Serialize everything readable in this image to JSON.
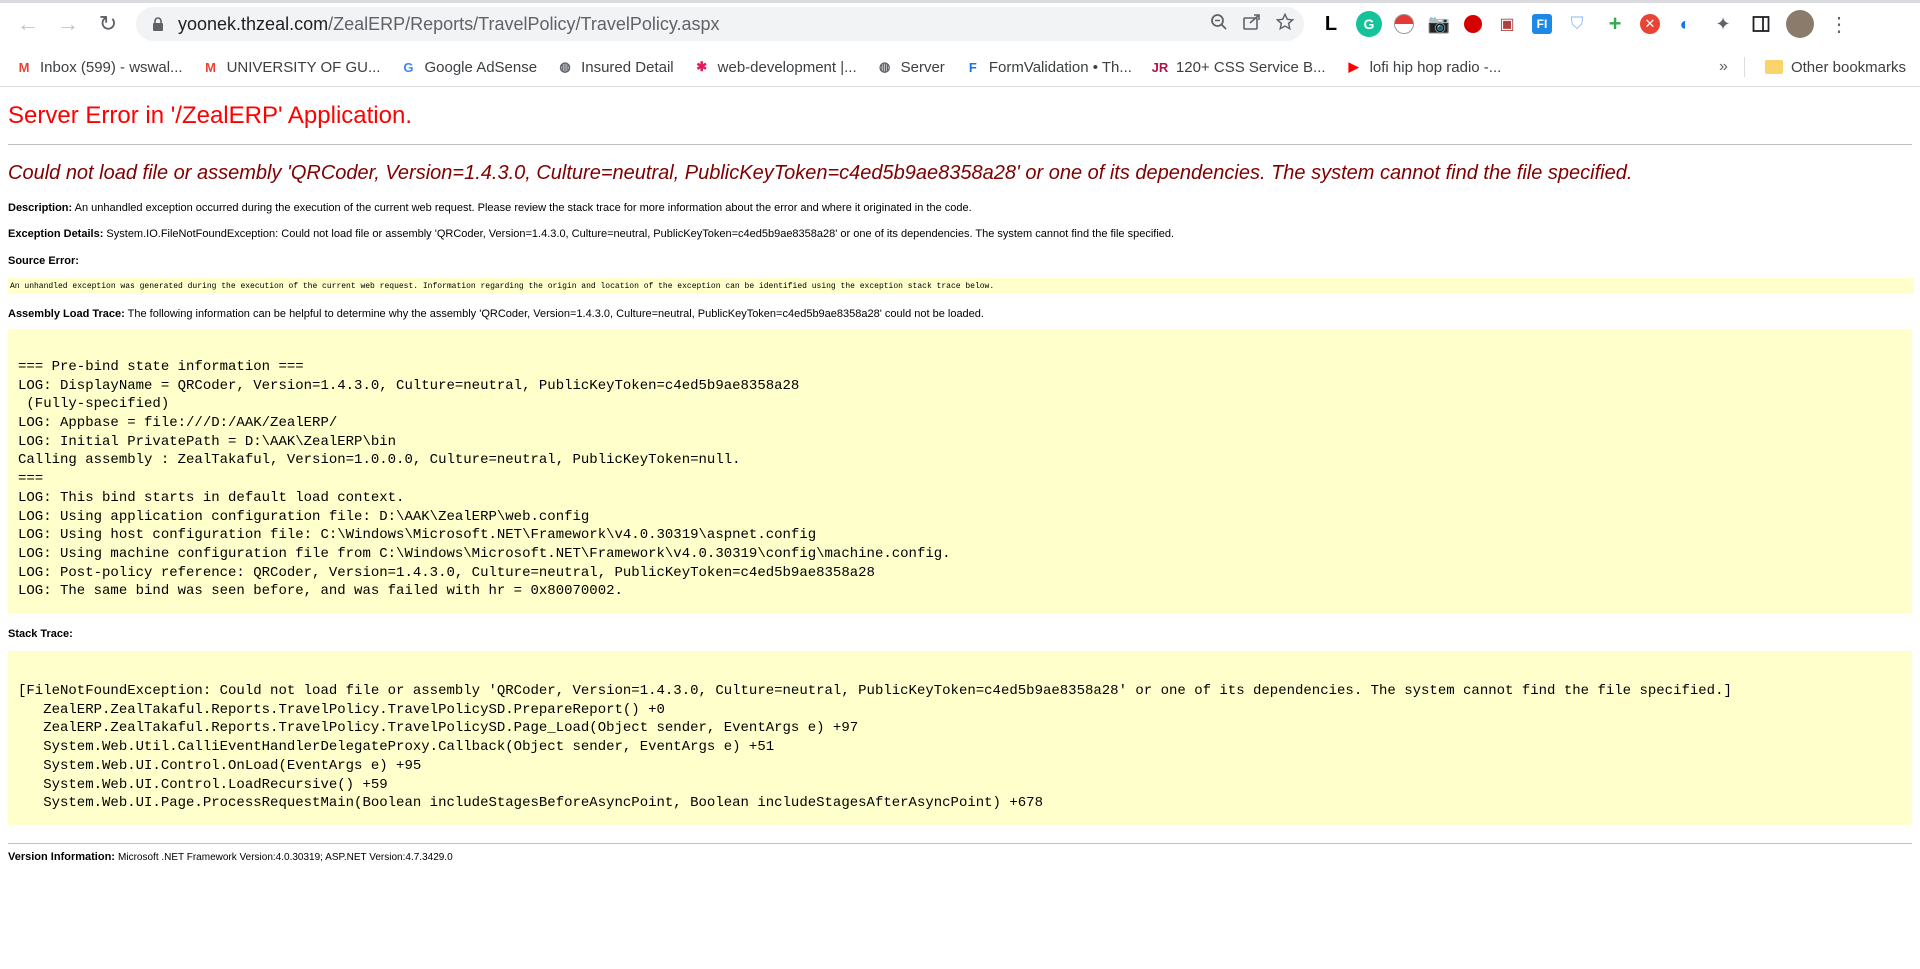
{
  "browser": {
    "url_host": "yoonek.thzeal.com",
    "url_path": "/ZealERP/Reports/TravelPolicy/TravelPolicy.aspx",
    "bookmarks": [
      {
        "label": "Inbox (599) - wswal...",
        "icon": "gmail-icon",
        "color": "#ea4335",
        "glyph": "M"
      },
      {
        "label": "UNIVERSITY OF GU...",
        "icon": "gmail-icon",
        "color": "#ea4335",
        "glyph": "M"
      },
      {
        "label": "Google AdSense",
        "icon": "google-icon",
        "color": "#4285f4",
        "glyph": "G"
      },
      {
        "label": "Insured Detail",
        "icon": "globe-icon",
        "color": "#5f6368",
        "glyph": "◍"
      },
      {
        "label": "web-development |...",
        "icon": "slack-icon",
        "color": "#e01e5a",
        "glyph": "✱"
      },
      {
        "label": "Server",
        "icon": "globe-icon",
        "color": "#5f6368",
        "glyph": "◍"
      },
      {
        "label": "FormValidation • Th...",
        "icon": "formvalidation-icon",
        "color": "#1a73e8",
        "glyph": "F"
      },
      {
        "label": "120+ CSS Service B...",
        "icon": "jr-icon",
        "color": "#b3134b",
        "glyph": "JR"
      },
      {
        "label": "lofi hip hop radio -...",
        "icon": "youtube-icon",
        "color": "#ff0000",
        "glyph": "▶"
      }
    ],
    "other_bookmarks": "Other bookmarks"
  },
  "page": {
    "title": "Server Error in '/ZealERP' Application.",
    "error_heading": "Could not load file or assembly 'QRCoder, Version=1.4.3.0, Culture=neutral, PublicKeyToken=c4ed5b9ae8358a28' or one of its dependencies. The system cannot find the file specified.",
    "description_label": "Description:",
    "description_text": "An unhandled exception occurred during the execution of the current web request. Please review the stack trace for more information about the error and where it originated in the code.",
    "exception_label": "Exception Details:",
    "exception_text": "System.IO.FileNotFoundException: Could not load file or assembly 'QRCoder, Version=1.4.3.0, Culture=neutral, PublicKeyToken=c4ed5b9ae8358a28' or one of its dependencies. The system cannot find the file specified.",
    "source_error_label": "Source Error:",
    "source_error_text": "An unhandled exception was generated during the execution of the current web request. Information regarding the origin and location of the exception can be identified using the exception stack trace below.",
    "assembly_label": "Assembly Load Trace:",
    "assembly_text": "The following information can be helpful to determine why the assembly 'QRCoder, Version=1.4.3.0, Culture=neutral, PublicKeyToken=c4ed5b9ae8358a28' could not be loaded.",
    "assembly_trace": "\n=== Pre-bind state information ===\nLOG: DisplayName = QRCoder, Version=1.4.3.0, Culture=neutral, PublicKeyToken=c4ed5b9ae8358a28\n (Fully-specified)\nLOG: Appbase = file:///D:/AAK/ZealERP/\nLOG: Initial PrivatePath = D:\\AAK\\ZealERP\\bin\nCalling assembly : ZealTakaful, Version=1.0.0.0, Culture=neutral, PublicKeyToken=null.\n===\nLOG: This bind starts in default load context.\nLOG: Using application configuration file: D:\\AAK\\ZealERP\\web.config\nLOG: Using host configuration file: C:\\Windows\\Microsoft.NET\\Framework\\v4.0.30319\\aspnet.config\nLOG: Using machine configuration file from C:\\Windows\\Microsoft.NET\\Framework\\v4.0.30319\\config\\machine.config.\nLOG: Post-policy reference: QRCoder, Version=1.4.3.0, Culture=neutral, PublicKeyToken=c4ed5b9ae8358a28\nLOG: The same bind was seen before, and was failed with hr = 0x80070002.",
    "stack_label": "Stack Trace:",
    "stack_trace": "\n[FileNotFoundException: Could not load file or assembly 'QRCoder, Version=1.4.3.0, Culture=neutral, PublicKeyToken=c4ed5b9ae8358a28' or one of its dependencies. The system cannot find the file specified.]\n   ZealERP.ZealTakaful.Reports.TravelPolicy.TravelPolicySD.PrepareReport() +0\n   ZealERP.ZealTakaful.Reports.TravelPolicy.TravelPolicySD.Page_Load(Object sender, EventArgs e) +97\n   System.Web.Util.CalliEventHandlerDelegateProxy.Callback(Object sender, EventArgs e) +51\n   System.Web.UI.Control.OnLoad(EventArgs e) +95\n   System.Web.UI.Control.LoadRecursive() +59\n   System.Web.UI.Page.ProcessRequestMain(Boolean includeStagesBeforeAsyncPoint, Boolean includeStagesAfterAsyncPoint) +678",
    "version_label": "Version Information:",
    "version_text": "Microsoft .NET Framework Version:4.0.30319; ASP.NET Version:4.7.3429.0"
  },
  "colors": {
    "title_red": "#ff0000",
    "heading_maroon": "#800000",
    "code_bg": "#ffffcc"
  }
}
